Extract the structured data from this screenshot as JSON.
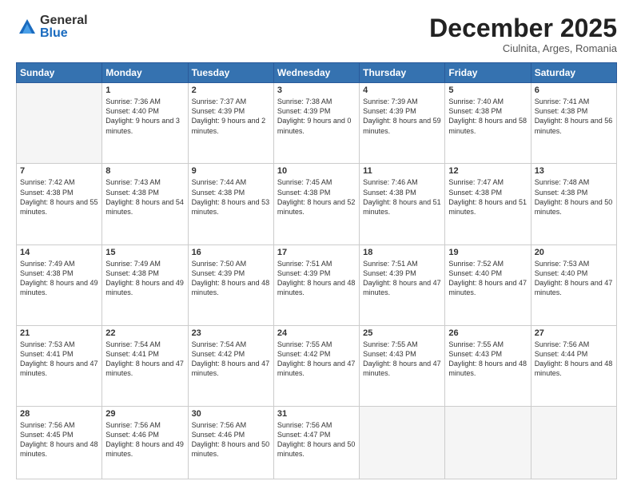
{
  "logo": {
    "general": "General",
    "blue": "Blue"
  },
  "header": {
    "month": "December 2025",
    "location": "Ciulnita, Arges, Romania"
  },
  "days_of_week": [
    "Sunday",
    "Monday",
    "Tuesday",
    "Wednesday",
    "Thursday",
    "Friday",
    "Saturday"
  ],
  "weeks": [
    [
      {
        "day": "",
        "empty": true
      },
      {
        "day": "1",
        "sunrise": "7:36 AM",
        "sunset": "4:40 PM",
        "daylight": "9 hours and 3 minutes."
      },
      {
        "day": "2",
        "sunrise": "7:37 AM",
        "sunset": "4:39 PM",
        "daylight": "9 hours and 2 minutes."
      },
      {
        "day": "3",
        "sunrise": "7:38 AM",
        "sunset": "4:39 PM",
        "daylight": "9 hours and 0 minutes."
      },
      {
        "day": "4",
        "sunrise": "7:39 AM",
        "sunset": "4:39 PM",
        "daylight": "8 hours and 59 minutes."
      },
      {
        "day": "5",
        "sunrise": "7:40 AM",
        "sunset": "4:38 PM",
        "daylight": "8 hours and 58 minutes."
      },
      {
        "day": "6",
        "sunrise": "7:41 AM",
        "sunset": "4:38 PM",
        "daylight": "8 hours and 56 minutes."
      }
    ],
    [
      {
        "day": "7",
        "sunrise": "7:42 AM",
        "sunset": "4:38 PM",
        "daylight": "8 hours and 55 minutes."
      },
      {
        "day": "8",
        "sunrise": "7:43 AM",
        "sunset": "4:38 PM",
        "daylight": "8 hours and 54 minutes."
      },
      {
        "day": "9",
        "sunrise": "7:44 AM",
        "sunset": "4:38 PM",
        "daylight": "8 hours and 53 minutes."
      },
      {
        "day": "10",
        "sunrise": "7:45 AM",
        "sunset": "4:38 PM",
        "daylight": "8 hours and 52 minutes."
      },
      {
        "day": "11",
        "sunrise": "7:46 AM",
        "sunset": "4:38 PM",
        "daylight": "8 hours and 51 minutes."
      },
      {
        "day": "12",
        "sunrise": "7:47 AM",
        "sunset": "4:38 PM",
        "daylight": "8 hours and 51 minutes."
      },
      {
        "day": "13",
        "sunrise": "7:48 AM",
        "sunset": "4:38 PM",
        "daylight": "8 hours and 50 minutes."
      }
    ],
    [
      {
        "day": "14",
        "sunrise": "7:49 AM",
        "sunset": "4:38 PM",
        "daylight": "8 hours and 49 minutes."
      },
      {
        "day": "15",
        "sunrise": "7:49 AM",
        "sunset": "4:38 PM",
        "daylight": "8 hours and 49 minutes."
      },
      {
        "day": "16",
        "sunrise": "7:50 AM",
        "sunset": "4:39 PM",
        "daylight": "8 hours and 48 minutes."
      },
      {
        "day": "17",
        "sunrise": "7:51 AM",
        "sunset": "4:39 PM",
        "daylight": "8 hours and 48 minutes."
      },
      {
        "day": "18",
        "sunrise": "7:51 AM",
        "sunset": "4:39 PM",
        "daylight": "8 hours and 47 minutes."
      },
      {
        "day": "19",
        "sunrise": "7:52 AM",
        "sunset": "4:40 PM",
        "daylight": "8 hours and 47 minutes."
      },
      {
        "day": "20",
        "sunrise": "7:53 AM",
        "sunset": "4:40 PM",
        "daylight": "8 hours and 47 minutes."
      }
    ],
    [
      {
        "day": "21",
        "sunrise": "7:53 AM",
        "sunset": "4:41 PM",
        "daylight": "8 hours and 47 minutes."
      },
      {
        "day": "22",
        "sunrise": "7:54 AM",
        "sunset": "4:41 PM",
        "daylight": "8 hours and 47 minutes."
      },
      {
        "day": "23",
        "sunrise": "7:54 AM",
        "sunset": "4:42 PM",
        "daylight": "8 hours and 47 minutes."
      },
      {
        "day": "24",
        "sunrise": "7:55 AM",
        "sunset": "4:42 PM",
        "daylight": "8 hours and 47 minutes."
      },
      {
        "day": "25",
        "sunrise": "7:55 AM",
        "sunset": "4:43 PM",
        "daylight": "8 hours and 47 minutes."
      },
      {
        "day": "26",
        "sunrise": "7:55 AM",
        "sunset": "4:43 PM",
        "daylight": "8 hours and 48 minutes."
      },
      {
        "day": "27",
        "sunrise": "7:56 AM",
        "sunset": "4:44 PM",
        "daylight": "8 hours and 48 minutes."
      }
    ],
    [
      {
        "day": "28",
        "sunrise": "7:56 AM",
        "sunset": "4:45 PM",
        "daylight": "8 hours and 48 minutes."
      },
      {
        "day": "29",
        "sunrise": "7:56 AM",
        "sunset": "4:46 PM",
        "daylight": "8 hours and 49 minutes."
      },
      {
        "day": "30",
        "sunrise": "7:56 AM",
        "sunset": "4:46 PM",
        "daylight": "8 hours and 50 minutes."
      },
      {
        "day": "31",
        "sunrise": "7:56 AM",
        "sunset": "4:47 PM",
        "daylight": "8 hours and 50 minutes."
      },
      {
        "day": "",
        "empty": true
      },
      {
        "day": "",
        "empty": true
      },
      {
        "day": "",
        "empty": true
      }
    ]
  ]
}
